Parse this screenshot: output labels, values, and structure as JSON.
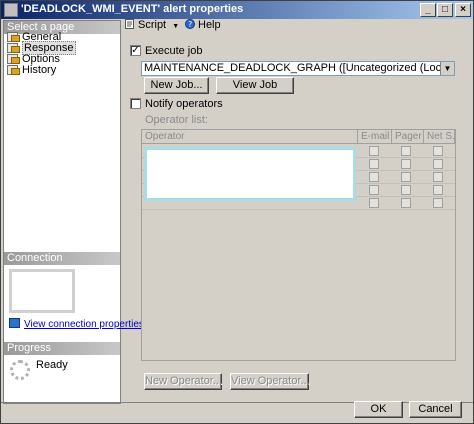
{
  "window": {
    "title": "'DEADLOCK_WMI_EVENT' alert properties",
    "controls": {
      "minimize": "_",
      "maximize": "□",
      "close": "×"
    }
  },
  "left_pane": {
    "select_page_header": "Select a page",
    "pages": [
      {
        "label": "General",
        "icon": "page-icon"
      },
      {
        "label": "Response",
        "icon": "page-icon",
        "selected": true
      },
      {
        "label": "Options",
        "icon": "page-icon"
      },
      {
        "label": "History",
        "icon": "page-icon"
      }
    ],
    "connection_header": "Connection",
    "connection_link": "View connection properties",
    "progress_header": "Progress",
    "progress_status": "Ready"
  },
  "toolbar": {
    "script_label": "Script",
    "help_label": "Help"
  },
  "response": {
    "execute_job_label": "Execute job",
    "execute_job_checked": true,
    "job_selected": "MAINTENANCE_DEADLOCK_GRAPH ([Uncategorized (Local)])",
    "new_job_label": "New Job...",
    "view_job_label": "View Job",
    "notify_operators_label": "Notify operators",
    "notify_operators_checked": false,
    "operator_list_label": "Operator list:",
    "columns": [
      "Operator",
      "E-mail",
      "Pager",
      "Net S..."
    ],
    "new_operator_label": "New Operator...",
    "view_operator_label": "View Operator..."
  },
  "footer": {
    "ok_label": "OK",
    "cancel_label": "Cancel"
  }
}
